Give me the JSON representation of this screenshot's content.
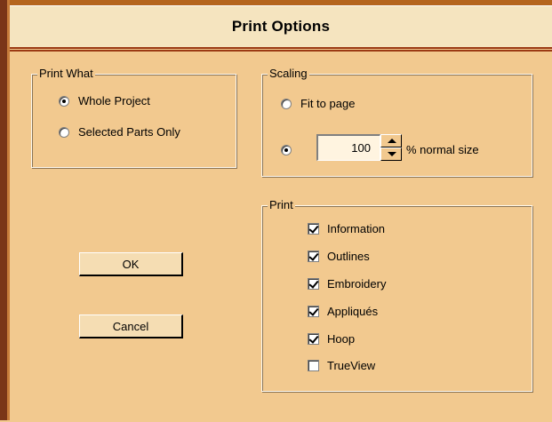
{
  "dialog": {
    "title": "Print Options"
  },
  "print_what": {
    "legend": "Print What",
    "options": [
      {
        "label": "Whole Project",
        "checked": true
      },
      {
        "label": "Selected Parts Only",
        "checked": false
      }
    ]
  },
  "scaling": {
    "legend": "Scaling",
    "fit_label": "Fit to page",
    "fit_checked": false,
    "percent_checked": true,
    "percent_value": "100",
    "percent_suffix": "% normal size"
  },
  "print": {
    "legend": "Print",
    "items": [
      {
        "label": "Information",
        "checked": true
      },
      {
        "label": "Outlines",
        "checked": true
      },
      {
        "label": "Embroidery",
        "checked": true
      },
      {
        "label": "Appliqués",
        "checked": true
      },
      {
        "label": "Hoop",
        "checked": true
      },
      {
        "label": "TrueView",
        "checked": false
      }
    ]
  },
  "buttons": {
    "ok": "OK",
    "cancel": "Cancel"
  },
  "colors": {
    "background": "#f2c98f",
    "title_bg": "#f5e4bf",
    "frame": "#7a3518"
  }
}
